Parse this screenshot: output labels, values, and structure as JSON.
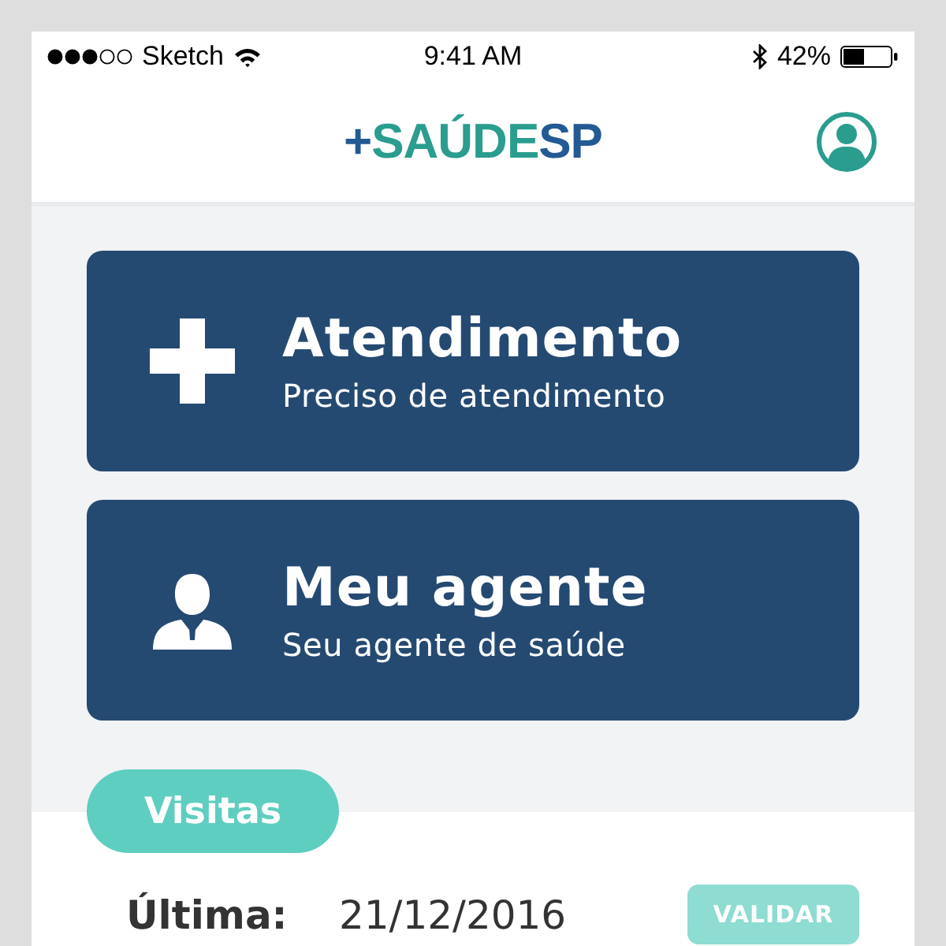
{
  "status_bar": {
    "carrier": "Sketch",
    "time": "9:41 AM",
    "battery": "42%"
  },
  "header": {
    "logo": {
      "mark": "+",
      "word": "SAÚDE",
      "suffix": "SP"
    }
  },
  "cards": [
    {
      "kind": "plus",
      "title": "Atendimento",
      "subtitle": "Preciso de atendimento"
    },
    {
      "kind": "agent",
      "title": "Meu agente",
      "subtitle": "Seu agente de saúde"
    }
  ],
  "visits": {
    "tab": "Visitas",
    "label": "Última:",
    "date": "21/12/2016",
    "button": {
      "label": "VALIDAR",
      "disabled": true
    }
  }
}
